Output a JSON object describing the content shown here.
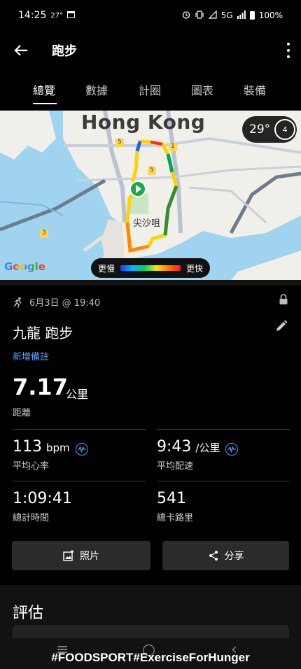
{
  "status_bar": {
    "time": "14:25",
    "temperature": "27°",
    "network": "5G",
    "battery": "100%"
  },
  "app_bar": {
    "title": "跑步"
  },
  "tabs": [
    "總覽",
    "數據",
    "計圈",
    "圖表",
    "裝備"
  ],
  "map": {
    "city_label": "Hong Kong",
    "district_label": "尖沙咀",
    "attribution": "Google",
    "weather_temp": "29°",
    "weather_badge_num": "4",
    "legend_slow": "更慢",
    "legend_fast": "更快",
    "road_labels": [
      "5",
      "1",
      "5",
      "3"
    ]
  },
  "activity": {
    "date": "6月3日 @ 19:40",
    "title": "九龍 跑步",
    "add_note": "新增備註"
  },
  "distance": {
    "value": "7.17",
    "unit": "公里",
    "label": "距離"
  },
  "metrics": {
    "heart_rate": {
      "value": "113",
      "unit": "bpm",
      "label": "平均心率"
    },
    "pace": {
      "value": "9:43",
      "unit": "/公里",
      "label": "平均配速"
    },
    "time": {
      "value": "1:09:41",
      "label": "總計時間"
    },
    "calories": {
      "value": "541",
      "label": "總卡路里"
    }
  },
  "buttons": {
    "photo": "照片",
    "share": "分享"
  },
  "section": {
    "title": "評估"
  },
  "watermark": "#FOODSPORT#ExerciseForHunger"
}
